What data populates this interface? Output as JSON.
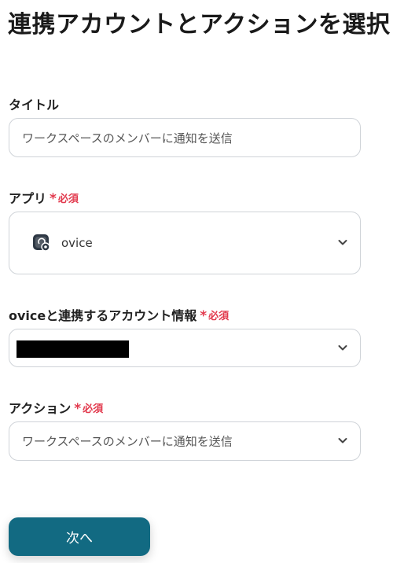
{
  "page": {
    "title": "連携アカウントとアクションを選択"
  },
  "required_label": "必須",
  "required_mark": "*",
  "fields": {
    "title": {
      "label": "タイトル",
      "value": "ワークスペースのメンバーに通知を送信"
    },
    "app": {
      "label": "アプリ",
      "value": "ovice",
      "icon": "ovice-app-icon"
    },
    "account": {
      "label": "oviceと連携するアカウント情報",
      "value_redacted": true
    },
    "action": {
      "label": "アクション",
      "value": "ワークスペースのメンバーに通知を送信"
    }
  },
  "buttons": {
    "next": "次へ"
  },
  "colors": {
    "required": "#e2394d",
    "primary_button": "#126a82",
    "border": "#cfd3d8"
  }
}
